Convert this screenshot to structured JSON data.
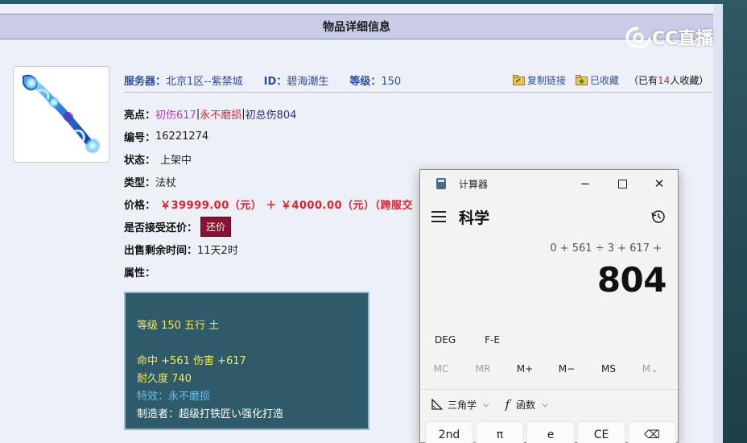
{
  "page": {
    "title": "物品详细信息"
  },
  "server_row": {
    "server_label": "服务器：",
    "server_value": "北京1区--紫禁城",
    "id_label": "ID：",
    "id_value": "碧海潮生",
    "level_label": "等级：",
    "level_value": "150",
    "copy_link_label": "复制链接",
    "favorited_label": "已收藏",
    "fav_count_prefix": "（已有",
    "fav_count": "14",
    "fav_count_suffix": "人收藏）"
  },
  "details": {
    "highlights_label": "亮点：",
    "highlight_1": "初伤617",
    "sep": "|",
    "highlight_2": "永不磨损",
    "highlight_3": "初总伤804",
    "number_label": "编号：",
    "number_value": "16221274",
    "status_label": "状态：",
    "status_value": "上架中",
    "type_label": "类型：",
    "type_value": "法杖",
    "price_label": "价格：",
    "price_value": "￥39999.00（元） ＋ ￥4000.00（元）（跨服交",
    "counter_label": "是否接受还价：",
    "counter_button": "还价",
    "time_label": "出售剩余时间：",
    "time_value": "11天2时",
    "attr_label": "属性："
  },
  "attributes": {
    "line1": "等级 150 五行 土",
    "line2": "命中 +561 伤害 +617",
    "line3": "耐久度 740",
    "line4": "特效：永不磨损",
    "line5": "制造者：超级打铁匠い强化打造"
  },
  "watermark": {
    "text": "CC直播"
  },
  "calculator": {
    "window_title": "计算器",
    "mode": "科学",
    "expression": "0 + 561 ÷ 3 + 617 +",
    "result": "804",
    "deg": "DEG",
    "fe": "F-E",
    "memory_keys": [
      "MC",
      "MR",
      "M+",
      "M−",
      "MS",
      "M⌄"
    ],
    "trig_label": "三角学",
    "func_label": "函数",
    "keys": [
      "2nd",
      "π",
      "e",
      "CE",
      "⌫"
    ]
  },
  "colors": {
    "title_bar": "#c8cce6",
    "attr_box": "#2f5a6a",
    "price_red": "#e0202a",
    "counter_button": "#8a1232"
  }
}
